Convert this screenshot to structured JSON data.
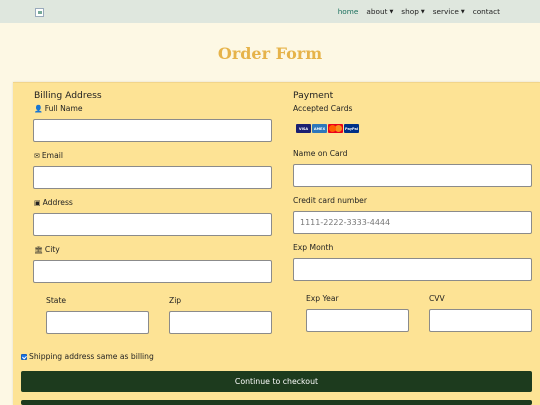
{
  "nav": {
    "items": [
      {
        "label": "home",
        "active": true,
        "dropdown": false
      },
      {
        "label": "about",
        "active": false,
        "dropdown": true
      },
      {
        "label": "shop",
        "active": false,
        "dropdown": true
      },
      {
        "label": "service",
        "active": false,
        "dropdown": true
      },
      {
        "label": "contact",
        "active": false,
        "dropdown": false
      }
    ],
    "caret": "▼"
  },
  "page": {
    "title": "Order Form"
  },
  "billing": {
    "title": "Billing Address",
    "full_name": {
      "label": "Full Name",
      "icon": "user-icon",
      "value": ""
    },
    "email": {
      "label": "Email",
      "icon": "envelope-icon",
      "value": ""
    },
    "address": {
      "label": "Address",
      "icon": "address-card-icon",
      "value": ""
    },
    "city": {
      "label": "City",
      "icon": "institution-icon",
      "value": ""
    },
    "state": {
      "label": "State",
      "value": ""
    },
    "zip": {
      "label": "Zip",
      "value": ""
    }
  },
  "payment": {
    "title": "Payment",
    "accepted_cards_label": "Accepted Cards",
    "cards": [
      "VISA",
      "AMEX",
      "MC",
      "PayPal"
    ],
    "name_on_card": {
      "label": "Name on Card",
      "value": ""
    },
    "card_number": {
      "label": "Credit card number",
      "placeholder": "1111-2222-3333-4444"
    },
    "exp_month": {
      "label": "Exp Month",
      "value": ""
    },
    "exp_year": {
      "label": "Exp Year",
      "value": ""
    },
    "cvv": {
      "label": "CVV",
      "value": ""
    }
  },
  "shipping_same": {
    "label": "Shipping address same as billing",
    "checked": true
  },
  "submit": {
    "label": "Continue to checkout"
  },
  "colors": {
    "navbar_bg": "#dfe7de",
    "page_bg": "#fdf8e4",
    "card_bg": "#fde395",
    "title_color": "#e6b34a",
    "button_bg": "#1d3b1e",
    "active_nav": "#1a6f5d"
  }
}
